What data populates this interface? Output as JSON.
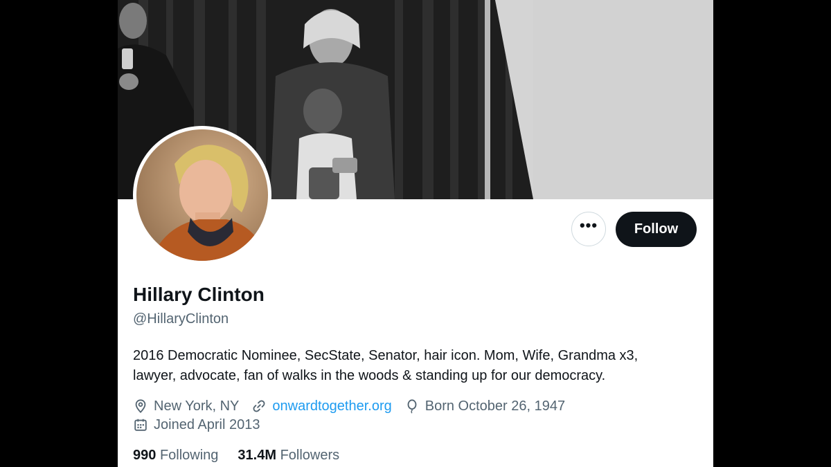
{
  "profile": {
    "display_name": "Hillary Clinton",
    "handle": "@HillaryClinton",
    "bio_line1": "2016 Democratic Nominee, SecState, Senator, hair icon. Mom, Wife, Grandma x3,",
    "bio_line2": "lawyer, advocate, fan of walks in the woods & standing up for our democracy.",
    "location": "New York, NY",
    "website": "onwardtogether.org",
    "birthday": "Born October 26, 1947",
    "joined": "Joined April 2013"
  },
  "actions": {
    "more_label": "•••",
    "follow_label": "Follow"
  },
  "stats": {
    "following_count": "990",
    "following_label": "Following",
    "followers_count": "31.4M",
    "followers_label": "Followers"
  },
  "colors": {
    "text_primary": "#0f1419",
    "text_secondary": "#536471",
    "link": "#1d9bf0",
    "follow_bg": "#0f1419"
  },
  "icons": {
    "location": "location-pin-icon",
    "website": "link-icon",
    "birthday": "balloon-icon",
    "joined": "calendar-icon"
  }
}
